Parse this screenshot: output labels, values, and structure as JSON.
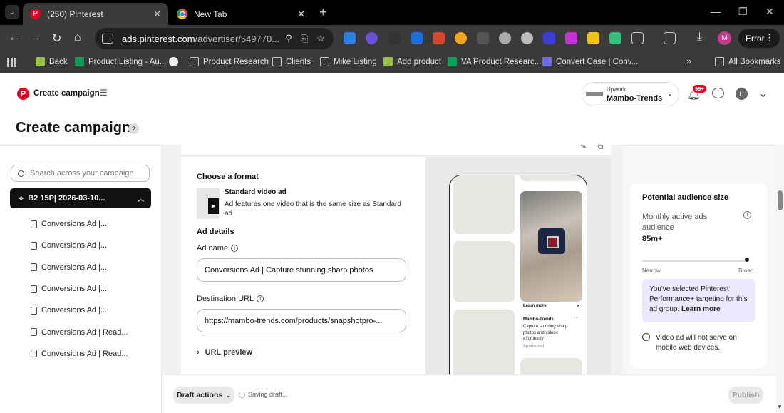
{
  "browser": {
    "tabs": [
      {
        "title": "(250) Pinterest",
        "active": true
      },
      {
        "title": "New Tab",
        "active": false
      }
    ],
    "address": {
      "host": "ads.pinterest.com",
      "path": "/advertiser/549770..."
    },
    "profile_initial": "M",
    "error_label": "Error",
    "bookmarks": [
      {
        "label": "Back",
        "icon": "shopify-icon"
      },
      {
        "label": "Product Listing - Au...",
        "icon": "sheets-icon"
      },
      {
        "label": "",
        "icon": "globe-icon"
      },
      {
        "label": "Product Research",
        "icon": "folder-icon"
      },
      {
        "label": "Clients",
        "icon": "folder-icon"
      },
      {
        "label": "Mike Listing",
        "icon": "folder-icon"
      },
      {
        "label": "Add product",
        "icon": "shopify-icon"
      },
      {
        "label": "VA Product Researc...",
        "icon": "sheets-icon"
      },
      {
        "label": "Convert Case | Conv...",
        "icon": "convertcase-icon"
      }
    ],
    "bookmarks_overflow": "»",
    "all_bookmarks": "All Bookmarks"
  },
  "header": {
    "brand": "Create campaign",
    "account_type": "Upwork",
    "account_name": "Mambo-Trends",
    "notifications_badge": "99+",
    "user_initial": "U"
  },
  "page_title": "Create campaign",
  "sidebar": {
    "search_placeholder": "Search across your campaign",
    "campaign": "B2 15P| 2026-03-10...",
    "ads": [
      "Conversions Ad |...",
      "Conversions Ad |...",
      "Conversions Ad |...",
      "Conversions Ad |...",
      "Conversions Ad |...",
      "Conversions Ad | Read...",
      "Conversions Ad | Read..."
    ]
  },
  "format": {
    "title": "Choose a format",
    "name": "Standard video ad",
    "description": "Ad features one video that is the same size as Standard ad"
  },
  "ad_details": {
    "title": "Ad details",
    "ad_name_label": "Ad name",
    "ad_name_value": "Conversions Ad | Capture stunning sharp photos",
    "url_label": "Destination URL",
    "url_value": "https://mambo-trends.com/products/snapshotpro-...",
    "url_preview": "URL preview"
  },
  "pin_preview": {
    "learn_more": "Learn more",
    "brand": "Mambo-Trends",
    "caption": "Capture stunning sharp photos and videos effortlessly",
    "sponsored": "Sponsored"
  },
  "audience": {
    "title": "Potential audience size",
    "metric_label": "Monthly active ads audience",
    "metric_value": "85m+",
    "slider_min": "Narrow",
    "slider_max": "Broad",
    "slider_position": 0.98,
    "notice_text": "You've selected Pinterest Performance+ targeting for this ad group. ",
    "notice_link": "Learn more",
    "warning": "Video ad will not serve on mobile web devices."
  },
  "footer": {
    "draft_actions": "Draft actions",
    "saving_status": "Saving draft...",
    "publish": "Publish"
  }
}
